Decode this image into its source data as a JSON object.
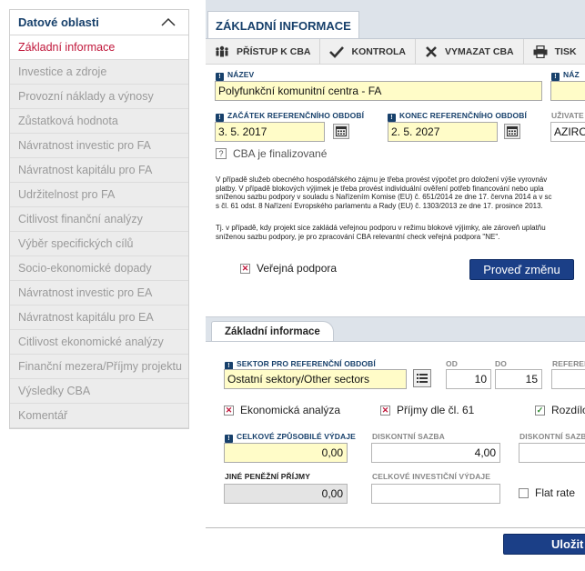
{
  "sidebar": {
    "title": "Datové oblasti",
    "items": [
      {
        "label": "Základní informace",
        "active": true
      },
      {
        "label": "Investice a zdroje"
      },
      {
        "label": "Provozní náklady a výnosy"
      },
      {
        "label": "Zůstatková hodnota"
      },
      {
        "label": "Návratnost investic pro FA"
      },
      {
        "label": "Návratnost kapitálu pro FA"
      },
      {
        "label": "Udržitelnost pro FA"
      },
      {
        "label": "Citlivost finanční analýzy"
      },
      {
        "label": "Výběr specifických cílů"
      },
      {
        "label": "Socio-ekonomické dopady"
      },
      {
        "label": "Návratnost investic pro EA"
      },
      {
        "label": "Návratnost kapitálu pro EA"
      },
      {
        "label": "Citlivost ekonomické analýzy"
      },
      {
        "label": "Finanční mezera/Příjmy projektu"
      },
      {
        "label": "Výsledky CBA"
      },
      {
        "label": "Komentář"
      }
    ]
  },
  "main": {
    "tab": "ZÁKLADNÍ INFORMACE"
  },
  "toolbar": {
    "access": "PŘÍSTUP K CBA",
    "check": "KONTROLA",
    "delete": "VYMAZAT CBA",
    "print": "TISK"
  },
  "form": {
    "name_label": "NÁZEV",
    "name_value": "Polyfunkční komunitní centra - FA",
    "name2_label": "NÁZ",
    "start_label": "ZAČÁTEK REFERENČNÍHO OBDOBÍ",
    "start_value": "3. 5. 2017",
    "end_label": "KONEC REFERENČNÍHO OBDOBÍ",
    "end_value": "2. 5. 2027",
    "user_label": "UŽIVATE",
    "user_value": "AZIRO",
    "finalized_label": "CBA je finalizované",
    "info1": "V případě služeb obecného hospodářského zájmu je třeba provést výpočet pro doložení výše vyrovnáv\nplatby. V případě blokových výjimek je třeba provést individuální ověření potřeb financování nebo upla\nsníženou sazbu podpory v souladu s Nařízením Komise (EU) č. 651/2014 ze dne 17. června 2014 a v sc\ns čl. 61 odst. 8 Nařízení Evropského parlamentu a Rady (EU) č. 1303/2013 ze dne 17. prosince 2013.",
    "info2": "Tj. v případě, kdy projekt sice zakládá veřejnou podporu v režimu blokové výjimky, ale zároveň uplatňu\nsníženou sazbu podpory, je pro zpracování CBA relevantní check veřejná podpora \"NE\".",
    "state_aid_label": "Veřejná podpora",
    "apply_change": "Proveď změnu"
  },
  "detail": {
    "tab": "Základní informace",
    "sector_label": "SEKTOR PRO REFERENČNÍ OBDOBÍ",
    "sector_value": "Ostatní sektory/Other sectors",
    "from_label": "OD",
    "from_value": "10",
    "to_label": "DO",
    "to_value": "15",
    "ref_label": "REFEREN",
    "econ_label": "Ekonomická analýza",
    "income_label": "Příjmy dle čl. 61",
    "diff_label": "Rozdílo",
    "eligible_label": "CELKOVÉ ZPŮSOBILÉ VÝDAJE",
    "eligible_value": "0,00",
    "discount_label": "DISKONTNÍ SAZBA",
    "discount_value": "4,00",
    "discount2_label": "DISKONTNÍ SAZBA",
    "other_label": "JINÉ PENĚŽNÍ PŘÍJMY",
    "other_value": "0,00",
    "invest_label": "CELKOVÉ INVESTIČNÍ VÝDAJE",
    "flat_label": "Flat rate",
    "save": "Uložit"
  }
}
